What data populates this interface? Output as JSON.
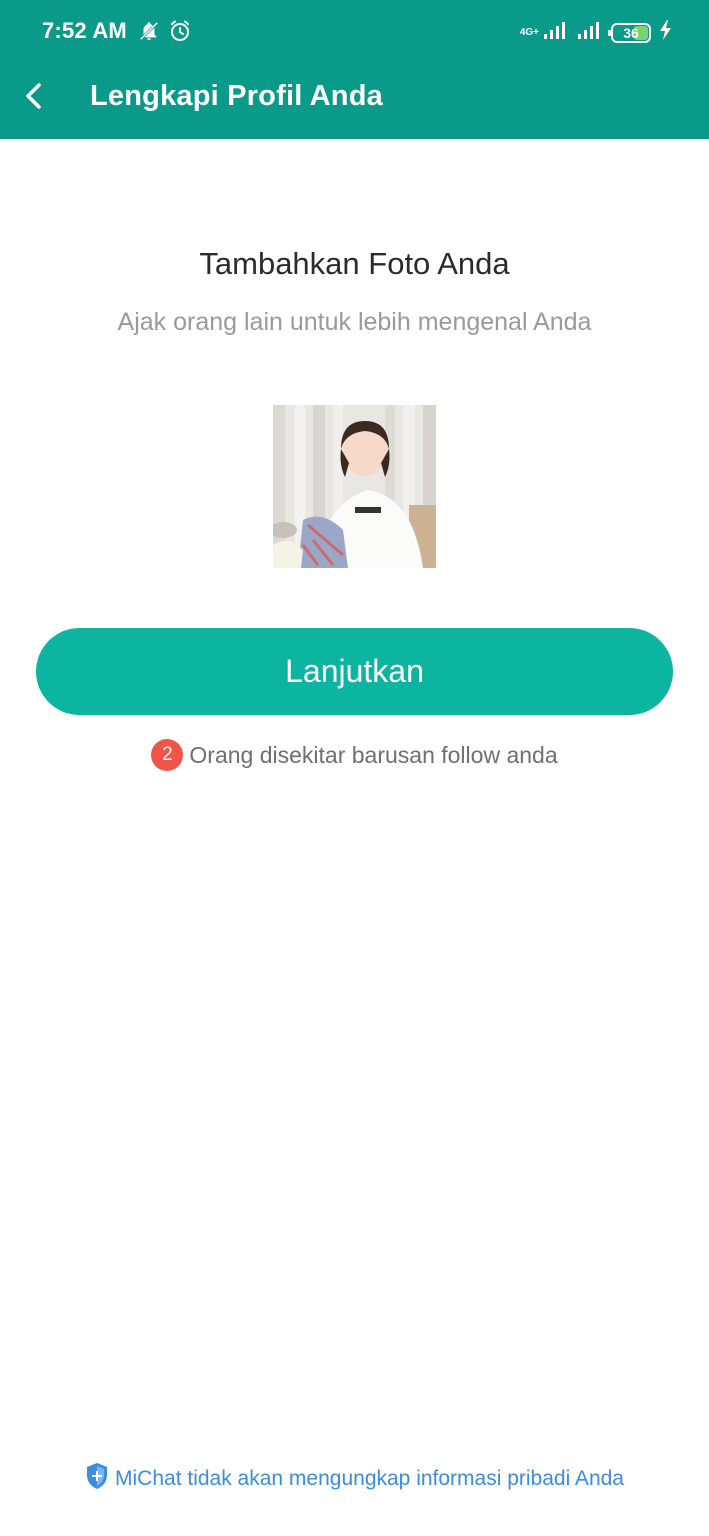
{
  "status_bar": {
    "time": "7:52 AM",
    "network_label": "4G+",
    "battery_level": "36",
    "icons": [
      "notifications-off-icon",
      "alarm-icon",
      "signal-icon",
      "signal-icon",
      "battery-icon",
      "charging-icon"
    ]
  },
  "header": {
    "title": "Lengkapi Profil Anda",
    "back_icon": "back-arrow-icon"
  },
  "main": {
    "heading": "Tambahkan Foto Anda",
    "subheading": "Ajak orang lain untuk lebih mengenal Anda",
    "continue_label": "Lanjutkan",
    "follow_count": "2",
    "follow_text": "Orang disekitar barusan follow anda"
  },
  "footer": {
    "privacy_text": "MiChat tidak akan mengungkap informasi pribadi Anda",
    "privacy_icon": "shield-icon"
  },
  "colors": {
    "header_bg": "#0a9a8a",
    "button_bg": "#0bb5a0",
    "badge": "#f0554a",
    "link": "#3a8de0"
  }
}
